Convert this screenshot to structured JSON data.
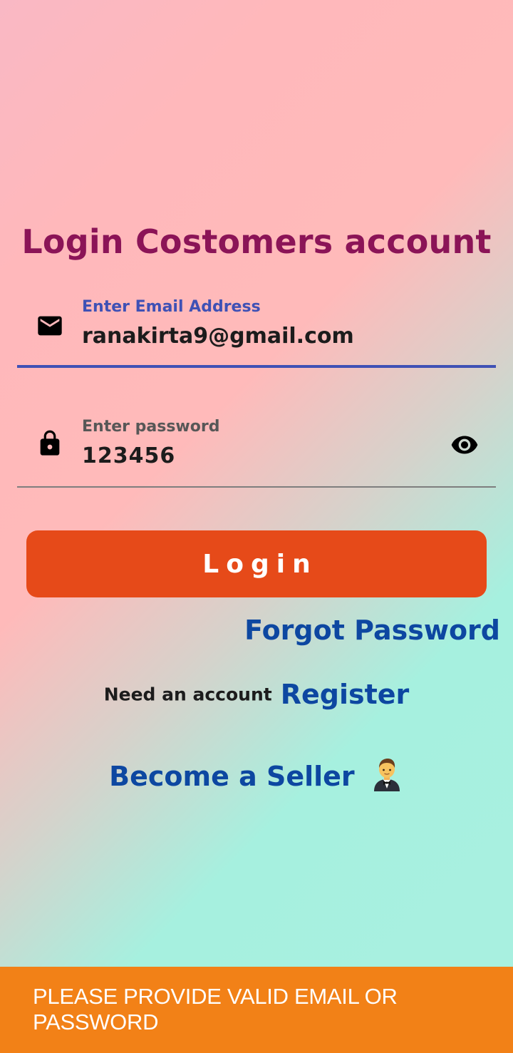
{
  "screen": {
    "title": "Login Costomers account"
  },
  "email_field": {
    "label": "Enter Email Address",
    "value": "ranakirta9@gmail.com",
    "icon": "mail-icon"
  },
  "password_field": {
    "label": "Enter password",
    "value": "123456",
    "icon": "lock-icon",
    "toggle_icon": "eye-icon"
  },
  "actions": {
    "login_label": "Login",
    "forgot_label": "Forgot Password",
    "need_account_text": "Need an account",
    "register_label": "Register",
    "seller_label": "Become a Seller",
    "seller_icon": "man-in-tuxedo-emoji"
  },
  "snackbar": {
    "message": "PLEASE PROVIDE VALID EMAIL OR PASSWORD"
  },
  "colors": {
    "title": "#8b1457",
    "accent": "#3f51b5",
    "login_button": "#e64a19",
    "link": "#0d47a1",
    "snackbar": "#f28117"
  }
}
